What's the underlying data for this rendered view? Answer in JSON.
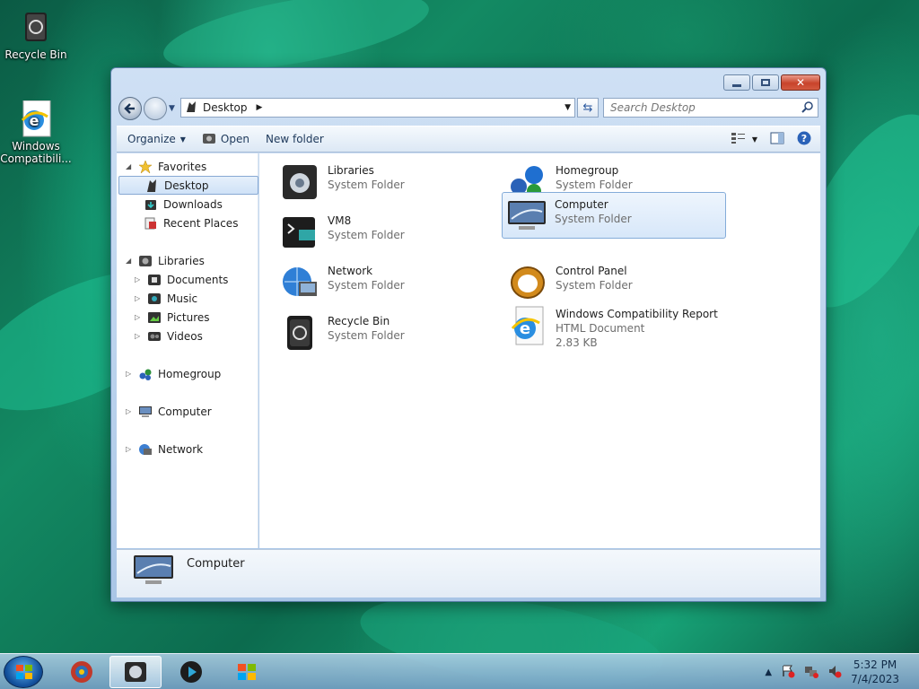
{
  "desktop": {
    "icons": [
      {
        "label": "Recycle Bin",
        "icon": "recycle-bin-icon"
      },
      {
        "label": "Windows Compatibili...",
        "icon": "internet-explorer-icon"
      }
    ]
  },
  "window": {
    "title": "Desktop",
    "address": {
      "crumb": "Desktop"
    },
    "search": {
      "placeholder": "Search Desktop"
    },
    "toolbar": {
      "organize": "Organize",
      "open": "Open",
      "new_folder": "New folder"
    },
    "nav_pane": {
      "favorites": {
        "label": "Favorites",
        "items": [
          "Desktop",
          "Downloads",
          "Recent Places"
        ]
      },
      "libraries": {
        "label": "Libraries",
        "items": [
          "Documents",
          "Music",
          "Pictures",
          "Videos"
        ]
      },
      "homegroup": "Homegroup",
      "computer": "Computer",
      "network": "Network"
    },
    "files": [
      {
        "name": "Libraries",
        "type": "System Folder",
        "icon": "libraries-icon"
      },
      {
        "name": "Homegroup",
        "type": "System Folder",
        "icon": "homegroup-icon"
      },
      {
        "name": "VM8",
        "type": "System Folder",
        "icon": "user-folder-icon"
      },
      {
        "name": "Computer",
        "type": "System Folder",
        "icon": "computer-icon",
        "selected": true
      },
      {
        "name": "Network",
        "type": "System Folder",
        "icon": "network-icon"
      },
      {
        "name": "Control Panel",
        "type": "System Folder",
        "icon": "control-panel-icon"
      },
      {
        "name": "Recycle Bin",
        "type": "System Folder",
        "icon": "recycle-bin-icon"
      },
      {
        "name": "Windows Compatibility Report",
        "type": "HTML Document",
        "size": "2.83 KB",
        "icon": "internet-explorer-icon"
      }
    ],
    "details": {
      "name": "Computer"
    }
  },
  "taskbar": {
    "clock": {
      "time": "5:32 PM",
      "date": "7/4/2023"
    }
  },
  "colors": {
    "accent": "#1e5aa0",
    "selection": "#d7e7f9",
    "wallpaper": "#138a63"
  }
}
